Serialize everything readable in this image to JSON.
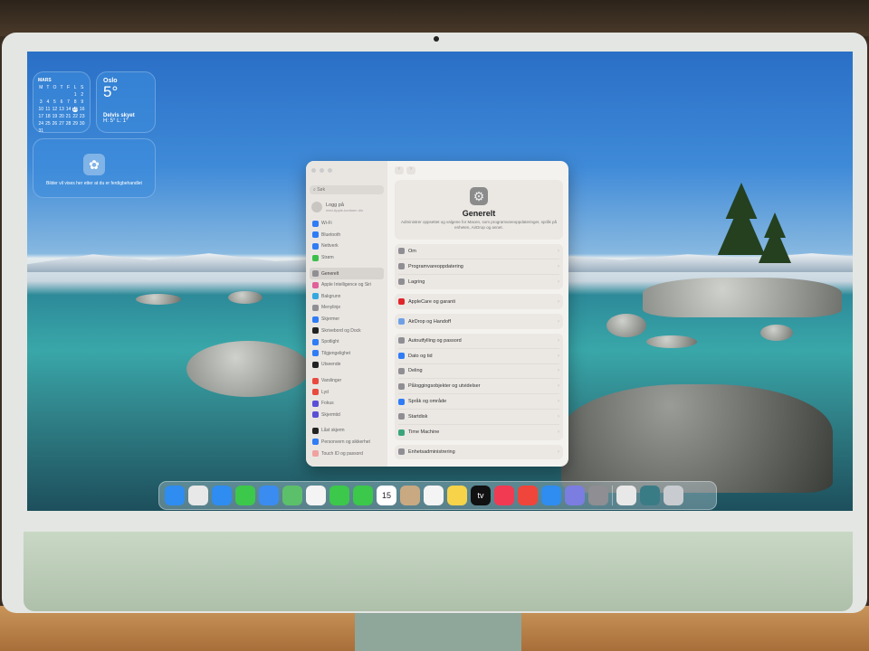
{
  "widgets": {
    "calendar": {
      "month": "MARS",
      "weekdays": [
        "M",
        "T",
        "O",
        "T",
        "F",
        "L",
        "S"
      ],
      "days": [
        "",
        "",
        "",
        "",
        "",
        "1",
        "2",
        "3",
        "4",
        "5",
        "6",
        "7",
        "8",
        "9",
        "10",
        "11",
        "12",
        "13",
        "14",
        "15",
        "16",
        "17",
        "18",
        "19",
        "20",
        "21",
        "22",
        "23",
        "24",
        "25",
        "26",
        "27",
        "28",
        "29",
        "30",
        "31"
      ],
      "today": "15"
    },
    "weather": {
      "city": "Oslo",
      "temp": "5°",
      "condition": "Delvis skyet",
      "hilo": "H: 5° L: 1°"
    },
    "photos": {
      "message": "Bilder vil vises her etter at du er ferdigbehandlet"
    }
  },
  "settings": {
    "search_placeholder": "Søk",
    "account": {
      "title": "Logg på",
      "subtitle": "med Apple-kontoen din"
    },
    "sidebar": [
      {
        "label": "Wi-Fi",
        "color": "#2f7cf6"
      },
      {
        "label": "Bluetooth",
        "color": "#2f7cf6"
      },
      {
        "label": "Nettverk",
        "color": "#2f7cf6"
      },
      {
        "label": "Strøm",
        "color": "#3cbf4a"
      },
      {
        "label": "Generelt",
        "color": "#8e8e93",
        "selected": true
      },
      {
        "label": "Apple Intelligence og Siri",
        "color": "#e0609a"
      },
      {
        "label": "Bakgrunn",
        "color": "#35a8e0"
      },
      {
        "label": "Menylinje",
        "color": "#8e8e93"
      },
      {
        "label": "Skjermer",
        "color": "#2f7cf6"
      },
      {
        "label": "Skrivebord og Dock",
        "color": "#222222"
      },
      {
        "label": "Spotlight",
        "color": "#2f7cf6"
      },
      {
        "label": "Tilgjengelighet",
        "color": "#2f7cf6"
      },
      {
        "label": "Utseende",
        "color": "#222222"
      },
      {
        "label": "Varslinger",
        "color": "#e94a3f"
      },
      {
        "label": "Lyd",
        "color": "#e94a3f"
      },
      {
        "label": "Fokus",
        "color": "#5a4fd6"
      },
      {
        "label": "Skjermtid",
        "color": "#5a4fd6"
      },
      {
        "label": "Låst skjerm",
        "color": "#222222"
      },
      {
        "label": "Personvern og sikkerhet",
        "color": "#2f7cf6"
      },
      {
        "label": "Touch ID og passord",
        "color": "#f0a0a0"
      }
    ],
    "panel": {
      "title": "Generelt",
      "description": "Administrer oppsettet og valgene for Macen, som programvareoppdateringer, språk på enheten, AirDrop og annet.",
      "groups": [
        [
          {
            "label": "Om",
            "color": "#8e8e93"
          },
          {
            "label": "Programvareoppdatering",
            "color": "#8e8e93"
          },
          {
            "label": "Lagring",
            "color": "#8e8e93"
          }
        ],
        [
          {
            "label": "AppleCare og garanti",
            "color": "#e0262a"
          }
        ],
        [
          {
            "label": "AirDrop og Handoff",
            "color": "#6fa0e6"
          }
        ],
        [
          {
            "label": "Autoutfylling og passord",
            "color": "#8e8e93"
          },
          {
            "label": "Dato og tid",
            "color": "#2f7cf6"
          },
          {
            "label": "Deling",
            "color": "#8e8e93"
          },
          {
            "label": "Påloggingsobjekter og utvidelser",
            "color": "#8e8e93"
          },
          {
            "label": "Språk og område",
            "color": "#2f7cf6"
          },
          {
            "label": "Startdisk",
            "color": "#8e8e93"
          },
          {
            "label": "Time Machine",
            "color": "#3aa57a"
          }
        ],
        [
          {
            "label": "Enhetsadministrering",
            "color": "#8e8e93"
          }
        ]
      ]
    }
  },
  "dock": [
    {
      "name": "finder",
      "color": "#2f8cf0"
    },
    {
      "name": "launchpad",
      "color": "#e8e8e8"
    },
    {
      "name": "safari",
      "color": "#2f8cf0"
    },
    {
      "name": "messages",
      "color": "#3cc84a"
    },
    {
      "name": "mail",
      "color": "#3a8cf0"
    },
    {
      "name": "maps",
      "color": "#5cc06a"
    },
    {
      "name": "photos",
      "color": "#f4f4f4"
    },
    {
      "name": "facetime",
      "color": "#3cc84a"
    },
    {
      "name": "phone",
      "color": "#3cc84a"
    },
    {
      "name": "calendar",
      "color": "#ffffff",
      "text": "15"
    },
    {
      "name": "contacts",
      "color": "#c9a982"
    },
    {
      "name": "reminders",
      "color": "#f4f4f4"
    },
    {
      "name": "notes",
      "color": "#f7d34a"
    },
    {
      "name": "tv",
      "color": "#111111",
      "text": "tv"
    },
    {
      "name": "music",
      "color": "#f23a53"
    },
    {
      "name": "games",
      "color": "#f0453a"
    },
    {
      "name": "app-store",
      "color": "#2f8cf0"
    },
    {
      "name": "iphone-mirroring",
      "color": "#7b7de0"
    },
    {
      "name": "system-settings",
      "color": "#8e8e93"
    },
    {
      "name": "sep"
    },
    {
      "name": "preview",
      "color": "#e8e8e8"
    },
    {
      "name": "downloads",
      "color": "#3a7c86"
    },
    {
      "name": "trash",
      "color": "#c8ccd0"
    }
  ]
}
